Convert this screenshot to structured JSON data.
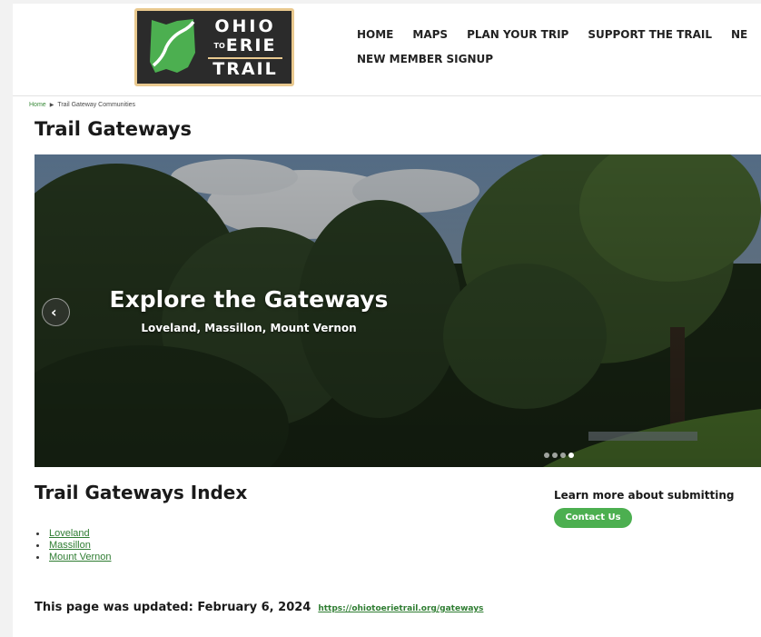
{
  "logo": {
    "line1": "OHIO",
    "to": "TO",
    "line2": "ERIE",
    "line3": "TRAIL"
  },
  "nav": {
    "row1": [
      "HOME",
      "MAPS",
      "PLAN YOUR TRIP",
      "SUPPORT THE TRAIL",
      "NE"
    ],
    "row2": [
      "NEW MEMBER SIGNUP"
    ]
  },
  "breadcrumb": {
    "home": "Home",
    "current": "Trail Gateway Communities"
  },
  "page_title": "Trail Gateways",
  "hero": {
    "title": "Explore the Gateways",
    "subtitle": "Loveland, Massillon, Mount Vernon",
    "prev_icon": "chevron-left-icon",
    "slides": 4,
    "active_slide": 4
  },
  "index": {
    "title": "Trail Gateways Index",
    "items": [
      "Loveland",
      "Massillon",
      "Mount Vernon"
    ]
  },
  "learn_more": "Learn more about submitting",
  "contact_button": "Contact Us",
  "updated": {
    "text": "This page was updated: February 6, 2024",
    "url": "https://ohiotoerietrail.org/gateways"
  },
  "colors": {
    "accent": "#4caf50",
    "link": "#2f7d32",
    "logo_bg": "#2b2b2b",
    "logo_border": "#e9c98f"
  }
}
